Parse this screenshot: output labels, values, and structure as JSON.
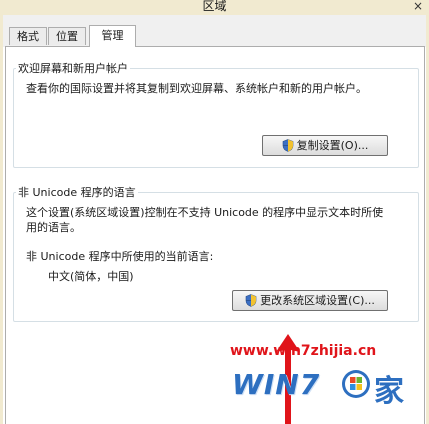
{
  "window": {
    "title": "区域",
    "close_glyph": "×"
  },
  "tabs": [
    {
      "label": "格式"
    },
    {
      "label": "位置"
    },
    {
      "label": "管理"
    }
  ],
  "welcome_group": {
    "title": "欢迎屏幕和新用户帐户",
    "description": "查看你的国际设置并将其复制到欢迎屏幕、系统帐户和新的用户帐户。",
    "copy_button_label": "复制设置(O)..."
  },
  "unicode_group": {
    "title": "非 Unicode 程序的语言",
    "description_line1": "这个设置(系统区域设置)控制在不支持 Unicode 的程序中显示文本时所使",
    "description_line2": "用的语言。",
    "current_language_label": "非 Unicode 程序中所使用的当前语言:",
    "current_language_value": "中文(简体，中国)",
    "change_button_label": "更改系统区域设置(C)..."
  },
  "watermark": {
    "url": "www.win7zhijia.cn",
    "logo_text": "WIN7",
    "logo_suffix": "家"
  },
  "colors": {
    "title_bar": "#f1ead0",
    "panel_border": "#adadad",
    "group_border": "#d5dfe5",
    "watermark_red": "#e0141a",
    "watermark_blue": "#2d6fc0"
  },
  "icons": {
    "button_icon": "uac-shield-icon",
    "close_icon": "close-icon",
    "annotation": "red-up-arrow-icon"
  }
}
